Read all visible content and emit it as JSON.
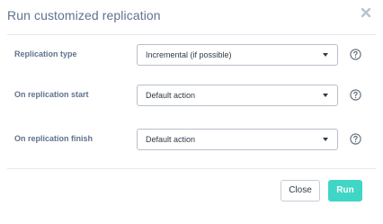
{
  "dialog": {
    "title": "Run customized replication",
    "close_icon": "close-icon"
  },
  "fields": [
    {
      "label": "Replication type",
      "value": "Incremental (if possible)",
      "help_icon": "question-circle-icon"
    },
    {
      "label": "On replication start",
      "value": "Default action",
      "help_icon": "question-circle-icon"
    },
    {
      "label": "On replication finish",
      "value": "Default action",
      "help_icon": "question-circle-icon"
    }
  ],
  "buttons": {
    "close_label": "Close",
    "run_label": "Run"
  },
  "colors": {
    "title": "#5f738d",
    "accent": "#3fd6c6",
    "border": "#b7c0cc"
  }
}
